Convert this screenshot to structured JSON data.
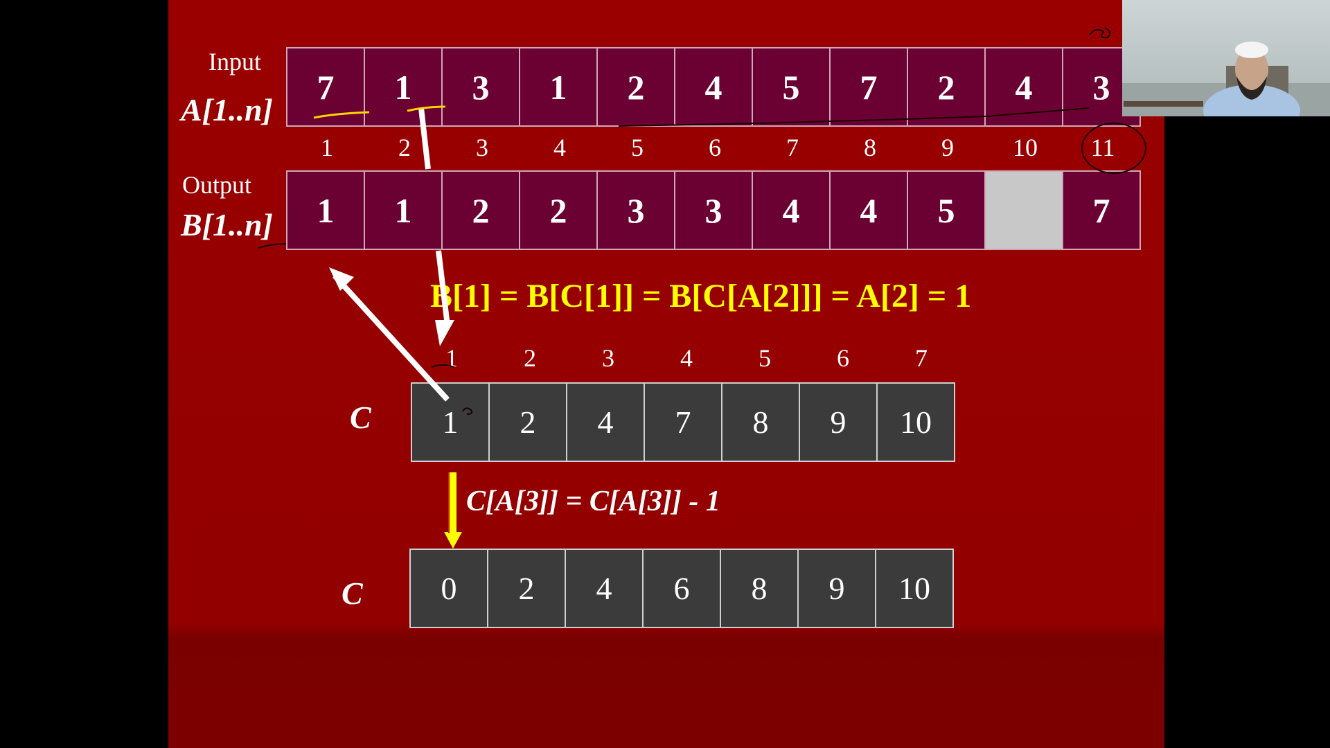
{
  "input": {
    "label": "Input",
    "array_label": "A[1..n]",
    "values": [
      "7",
      "1",
      "3",
      "1",
      "2",
      "4",
      "5",
      "7",
      "2",
      "4",
      "3"
    ],
    "indices": [
      "1",
      "2",
      "3",
      "4",
      "5",
      "6",
      "7",
      "8",
      "9",
      "10",
      "11"
    ]
  },
  "output": {
    "label": "Output",
    "array_label": "B[1..n]",
    "values": [
      "1",
      "1",
      "2",
      "2",
      "3",
      "3",
      "4",
      "4",
      "5",
      "",
      "7"
    ]
  },
  "formula_b": "B[1] = B[C[1]] = B[C[A[2]]] = A[2] = 1",
  "c_indices": [
    "1",
    "2",
    "3",
    "4",
    "5",
    "6",
    "7"
  ],
  "c_top": {
    "label": "C",
    "values": [
      "1",
      "2",
      "4",
      "7",
      "8",
      "9",
      "10"
    ]
  },
  "formula_c": "C[A[3]] = C[A[3]] - 1",
  "c_bottom": {
    "label": "C",
    "values": [
      "0",
      "2",
      "4",
      "6",
      "8",
      "9",
      "10"
    ]
  },
  "colors": {
    "slide_bg": "#9a0000",
    "array_cell": "#6b0033",
    "empty_cell": "#c8c8c8",
    "c_cell": "#3b3b3b",
    "formula": "#ffff00"
  }
}
